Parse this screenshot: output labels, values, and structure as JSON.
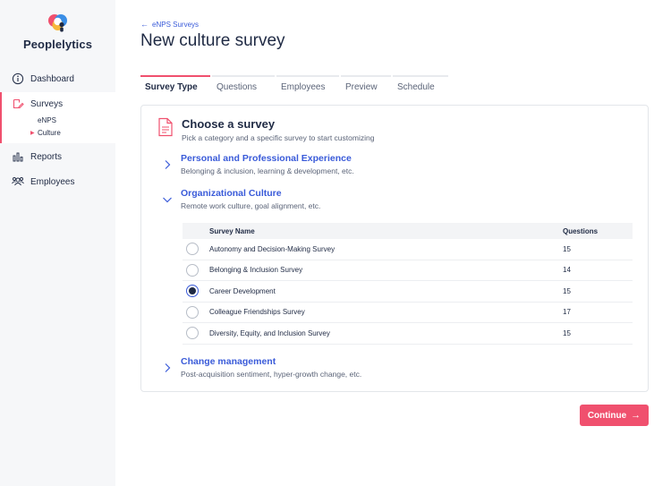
{
  "app": {
    "name": "Peoplelytics"
  },
  "sidebar": {
    "items": [
      {
        "label": "Dashboard",
        "icon": "info-circle-icon"
      },
      {
        "label": "Surveys",
        "icon": "survey-edit-icon",
        "active": true,
        "children": [
          {
            "label": "eNPS"
          },
          {
            "label": "Culture",
            "active": true
          }
        ]
      },
      {
        "label": "Reports",
        "icon": "bar-chart-icon"
      },
      {
        "label": "Employees",
        "icon": "people-icon"
      }
    ]
  },
  "header": {
    "breadcrumb": "eNPS Surveys",
    "title": "New culture survey"
  },
  "tabs": [
    {
      "label": "Survey Type",
      "active": true
    },
    {
      "label": "Questions"
    },
    {
      "label": "Employees"
    },
    {
      "label": "Preview"
    },
    {
      "label": "Schedule"
    }
  ],
  "card": {
    "title": "Choose a survey",
    "subtitle": "Pick a category and a specific survey to start customizing",
    "categories": [
      {
        "name": "Personal and Professional Experience",
        "desc": "Belonging & inclusion, learning & development, etc.",
        "expanded": false
      },
      {
        "name": "Organizational Culture",
        "desc": "Remote work culture, goal alignment, etc.",
        "expanded": true
      },
      {
        "name": "Change management",
        "desc": "Post-acquisition sentiment, hyper-growth change, etc.",
        "expanded": false
      }
    ],
    "table": {
      "headers": {
        "name": "Survey Name",
        "questions": "Questions"
      },
      "rows": [
        {
          "name": "Autonomy and Decision-Making Survey",
          "questions": "15",
          "selected": false
        },
        {
          "name": "Belonging & Inclusion Survey",
          "questions": "14",
          "selected": false
        },
        {
          "name": "Career Development",
          "questions": "15",
          "selected": true
        },
        {
          "name": "Colleague Friendships Survey",
          "questions": "17",
          "selected": false
        },
        {
          "name": "Diversity, Equity, and Inclusion Survey",
          "questions": "15",
          "selected": false
        }
      ]
    }
  },
  "actions": {
    "continue_label": "Continue"
  },
  "colors": {
    "accent": "#f0506e",
    "link": "#3a5bd9",
    "text": "#1f2a44"
  }
}
